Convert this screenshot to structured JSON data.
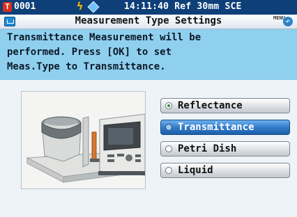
{
  "status": {
    "badge": "T",
    "instrument_no": "0001",
    "time_info": "14:11:40 Ref 30mm SCE"
  },
  "header": {
    "title": "Measurement Type Settings",
    "menu_label": "MENU"
  },
  "message": {
    "line1": "Transmittance Measurement will be",
    "line2": "performed. Press [OK] to set",
    "line3": "Meas.Type to Transmittance."
  },
  "options": [
    {
      "label": "Reflectance",
      "checked": true
    },
    {
      "label": "Transmittance",
      "highlighted": true
    },
    {
      "label": "Petri Dish"
    },
    {
      "label": "Liquid"
    }
  ],
  "colors": {
    "status_bar": "#0f3f78",
    "message_bg": "#8fd0ee",
    "highlight": "#2f78c7"
  }
}
